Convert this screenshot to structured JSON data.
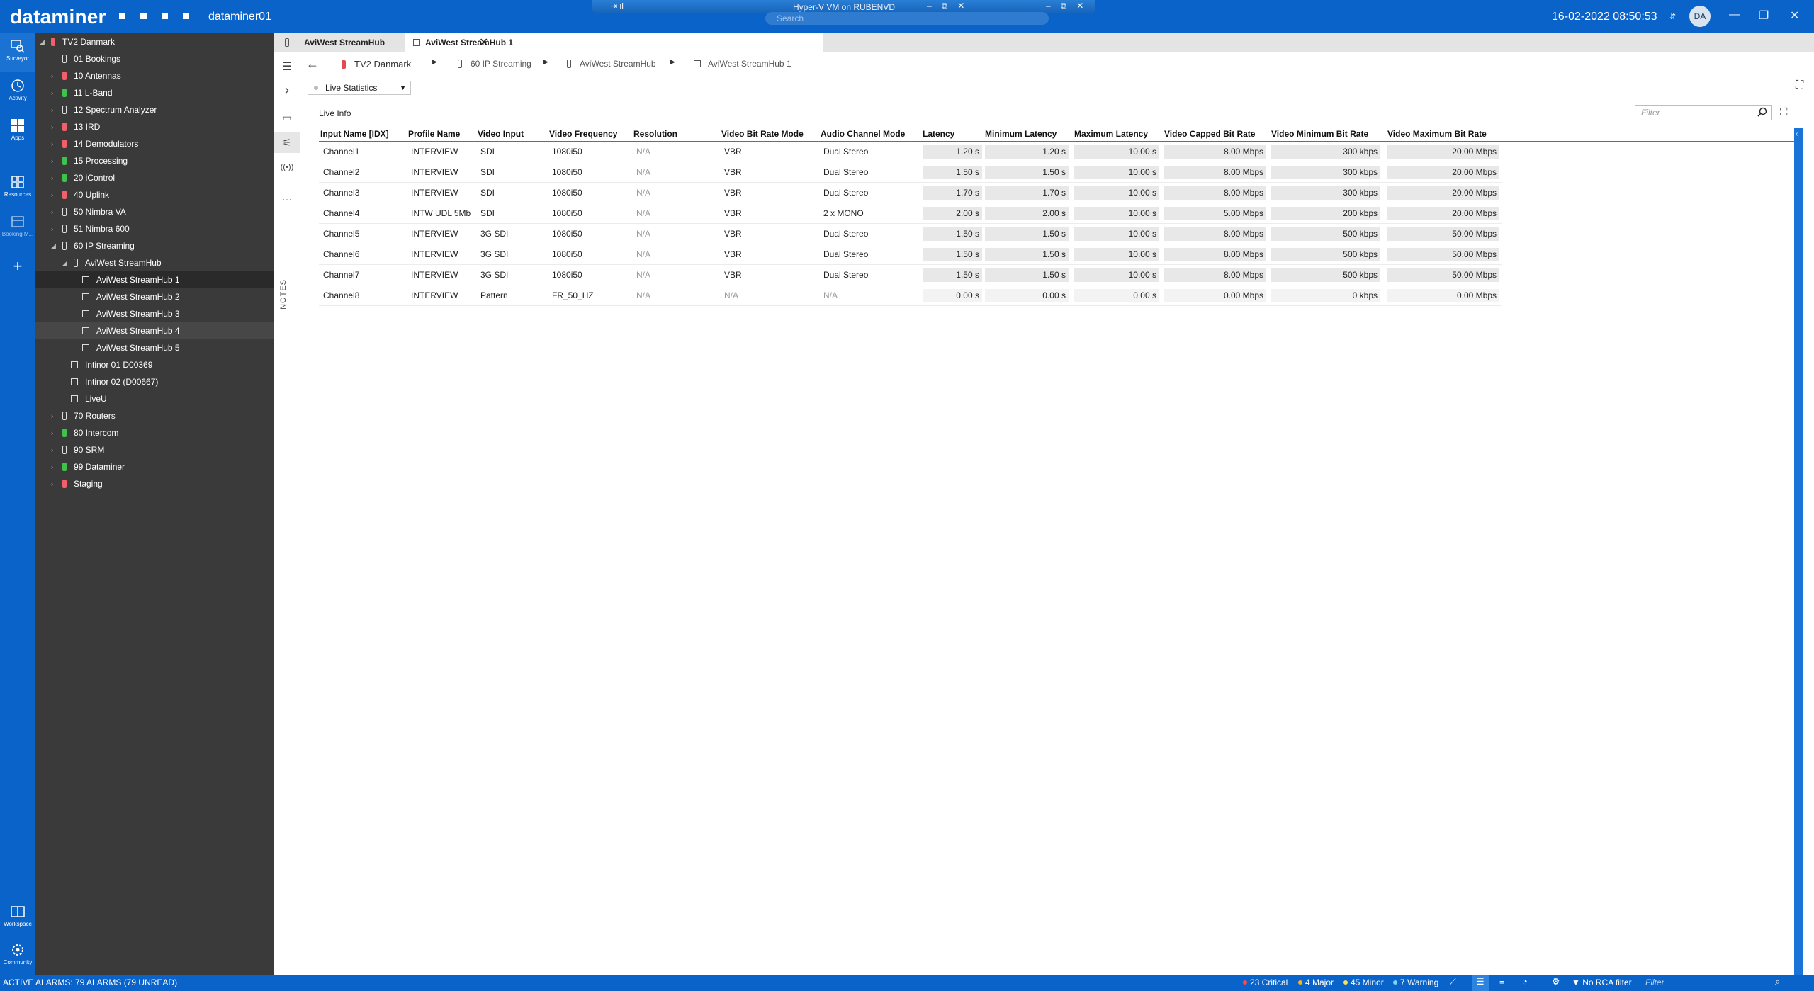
{
  "titlebar": {
    "brand": "dataminer",
    "host": "dataminer01",
    "hyperv_title": "Hyper-V VM on RUBENVD",
    "search_placeholder": "Search",
    "datetime": "16-02-2022 08:50:53",
    "user_initials": "DA"
  },
  "rail": {
    "surveyor": "Surveyor",
    "activity": "Activity",
    "apps": "Apps",
    "resources": "Resources",
    "booking": "Booking M...",
    "workspace": "Workspace",
    "community": "Community"
  },
  "tree": [
    {
      "label": "TV2 Danmark",
      "state": "red"
    },
    {
      "label": "01 Bookings",
      "state": "empty"
    },
    {
      "label": "10 Antennas",
      "state": "red"
    },
    {
      "label": "11 L-Band",
      "state": "green"
    },
    {
      "label": "12 Spectrum Analyzer",
      "state": "empty"
    },
    {
      "label": "13 IRD",
      "state": "red"
    },
    {
      "label": "14 Demodulators",
      "state": "red"
    },
    {
      "label": "15 Processing",
      "state": "green"
    },
    {
      "label": "20 iControl",
      "state": "green"
    },
    {
      "label": "40 Uplink",
      "state": "red"
    },
    {
      "label": "50 Nimbra VA",
      "state": "empty"
    },
    {
      "label": "51 Nimbra 600",
      "state": "empty"
    },
    {
      "label": "60 IP Streaming",
      "state": "empty"
    },
    {
      "label": "AviWest StreamHub",
      "state": "empty"
    },
    {
      "label": "AviWest StreamHub 1",
      "state": "box"
    },
    {
      "label": "AviWest StreamHub 2",
      "state": "box"
    },
    {
      "label": "AviWest StreamHub 3",
      "state": "box"
    },
    {
      "label": "AviWest StreamHub 4",
      "state": "box"
    },
    {
      "label": "AviWest StreamHub 5",
      "state": "box"
    },
    {
      "label": "Intinor 01 D00369",
      "state": "box"
    },
    {
      "label": "Intinor 02 (D00667)",
      "state": "box"
    },
    {
      "label": "LiveU",
      "state": "box"
    },
    {
      "label": "70 Routers",
      "state": "empty"
    },
    {
      "label": "80 Intercom",
      "state": "green"
    },
    {
      "label": "90 SRM",
      "state": "empty"
    },
    {
      "label": "99 Dataminer",
      "state": "green"
    },
    {
      "label": "Staging",
      "state": "red"
    }
  ],
  "tabs": [
    {
      "label": "AviWest StreamHub"
    },
    {
      "label": "AviWest StreamHub 1"
    }
  ],
  "breadcrumb": [
    "TV2 Danmark",
    "60 IP Streaming",
    "AviWest StreamHub",
    "AviWest StreamHub 1"
  ],
  "notes_label": "NOTES",
  "page_select": "Live Statistics",
  "table": {
    "title": "Live Info",
    "filter_placeholder": "Filter",
    "columns": [
      "Input Name [IDX]",
      "Profile Name",
      "Video Input",
      "Video Frequency",
      "Resolution",
      "Video Bit Rate Mode",
      "Audio Channel Mode",
      "Latency",
      "Minimum Latency",
      "Maximum Latency",
      "Video Capped Bit Rate",
      "Video Minimum Bit Rate",
      "Video Maximum Bit Rate"
    ],
    "rows": [
      [
        "Channel1",
        "INTERVIEW",
        "SDI",
        "1080i50",
        "N/A",
        "VBR",
        "Dual Stereo",
        "1.20 s",
        "1.20 s",
        "10.00 s",
        "8.00 Mbps",
        "300 kbps",
        "20.00 Mbps"
      ],
      [
        "Channel2",
        "INTERVIEW",
        "SDI",
        "1080i50",
        "N/A",
        "VBR",
        "Dual Stereo",
        "1.50 s",
        "1.50 s",
        "10.00 s",
        "8.00 Mbps",
        "300 kbps",
        "20.00 Mbps"
      ],
      [
        "Channel3",
        "INTERVIEW",
        "SDI",
        "1080i50",
        "N/A",
        "VBR",
        "Dual Stereo",
        "1.70 s",
        "1.70 s",
        "10.00 s",
        "8.00 Mbps",
        "300 kbps",
        "20.00 Mbps"
      ],
      [
        "Channel4",
        "INTW UDL 5Mb",
        "SDI",
        "1080i50",
        "N/A",
        "VBR",
        "2 x MONO",
        "2.00 s",
        "2.00 s",
        "10.00 s",
        "5.00 Mbps",
        "200 kbps",
        "20.00 Mbps"
      ],
      [
        "Channel5",
        "INTERVIEW",
        "3G SDI",
        "1080i50",
        "N/A",
        "VBR",
        "Dual Stereo",
        "1.50 s",
        "1.50 s",
        "10.00 s",
        "8.00 Mbps",
        "500 kbps",
        "50.00 Mbps"
      ],
      [
        "Channel6",
        "INTERVIEW",
        "3G SDI",
        "1080i50",
        "N/A",
        "VBR",
        "Dual Stereo",
        "1.50 s",
        "1.50 s",
        "10.00 s",
        "8.00 Mbps",
        "500 kbps",
        "50.00 Mbps"
      ],
      [
        "Channel7",
        "INTERVIEW",
        "3G SDI",
        "1080i50",
        "N/A",
        "VBR",
        "Dual Stereo",
        "1.50 s",
        "1.50 s",
        "10.00 s",
        "8.00 Mbps",
        "500 kbps",
        "50.00 Mbps"
      ],
      [
        "Channel8",
        "INTERVIEW",
        "Pattern",
        "FR_50_HZ",
        "N/A",
        "N/A",
        "N/A",
        "0.00 s",
        "0.00 s",
        "0.00 s",
        "0.00 Mbps",
        "0 kbps",
        "0.00 Mbps"
      ]
    ]
  },
  "statusbar": {
    "active_alarms": "ACTIVE ALARMS: 79 ALARMS (79 UNREAD)",
    "critical": "23 Critical",
    "major": "4 Major",
    "minor": "45 Minor",
    "warning": "7 Warning",
    "rca": "No RCA filter",
    "filter_placeholder": "Filter"
  },
  "colors": {
    "brand_blue": "#0a63c9",
    "critical": "#ff4b4b",
    "major": "#ffb020",
    "minor": "#ffe14d",
    "warning": "#7fd3ff"
  }
}
